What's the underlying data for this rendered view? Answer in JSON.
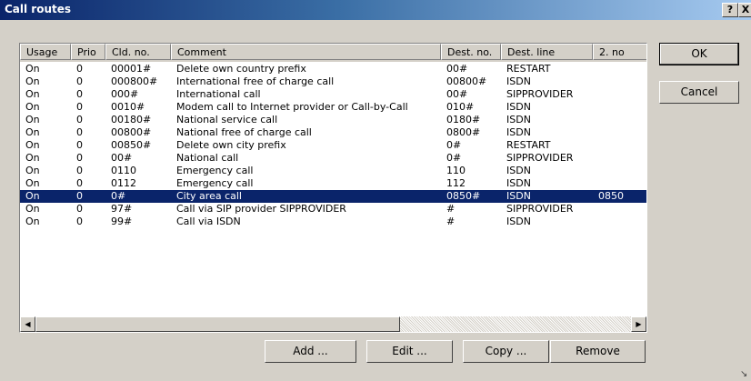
{
  "window": {
    "title": "Call routes",
    "help_label": "?",
    "close_label": "X"
  },
  "table": {
    "columns": [
      "Usage",
      "Prio",
      "Cld. no.",
      "Comment",
      "Dest. no.",
      "Dest. line",
      "2. no"
    ],
    "rows": [
      [
        "On",
        "0",
        "00001#",
        "Delete own country prefix",
        "00#",
        "RESTART",
        ""
      ],
      [
        "On",
        "0",
        "000800#",
        "International free of charge call",
        "00800#",
        "ISDN",
        ""
      ],
      [
        "On",
        "0",
        "000#",
        "International call",
        "00#",
        "SIPPROVIDER",
        ""
      ],
      [
        "On",
        "0",
        "0010#",
        "Modem call to Internet provider or Call-by-Call",
        "010#",
        "ISDN",
        ""
      ],
      [
        "On",
        "0",
        "00180#",
        "National service call",
        "0180#",
        "ISDN",
        ""
      ],
      [
        "On",
        "0",
        "00800#",
        "National free of charge call",
        "0800#",
        "ISDN",
        ""
      ],
      [
        "On",
        "0",
        "00850#",
        "Delete own city prefix",
        "0#",
        "RESTART",
        ""
      ],
      [
        "On",
        "0",
        "00#",
        "National call",
        "0#",
        "SIPPROVIDER",
        ""
      ],
      [
        "On",
        "0",
        "0110",
        "Emergency call",
        "110",
        "ISDN",
        ""
      ],
      [
        "On",
        "0",
        "0112",
        "Emergency call",
        "112",
        "ISDN",
        ""
      ],
      [
        "On",
        "0",
        "0#",
        "City area call",
        "0850#",
        "ISDN",
        "0850"
      ],
      [
        "On",
        "0",
        "97#",
        "Call via SIP provider SIPPROVIDER",
        "#",
        "SIPPROVIDER",
        ""
      ],
      [
        "On",
        "0",
        "99#",
        "Call via ISDN",
        "#",
        "ISDN",
        ""
      ]
    ],
    "selected_row": 10
  },
  "scrollbar": {
    "left_arrow": "◀",
    "right_arrow": "▶"
  },
  "buttons": {
    "ok": "OK",
    "cancel": "Cancel",
    "add": "Add ...",
    "edit": "Edit ...",
    "copy": "Copy ...",
    "remove": "Remove"
  },
  "icons": {
    "resize_grip": "resize-grip-icon"
  }
}
